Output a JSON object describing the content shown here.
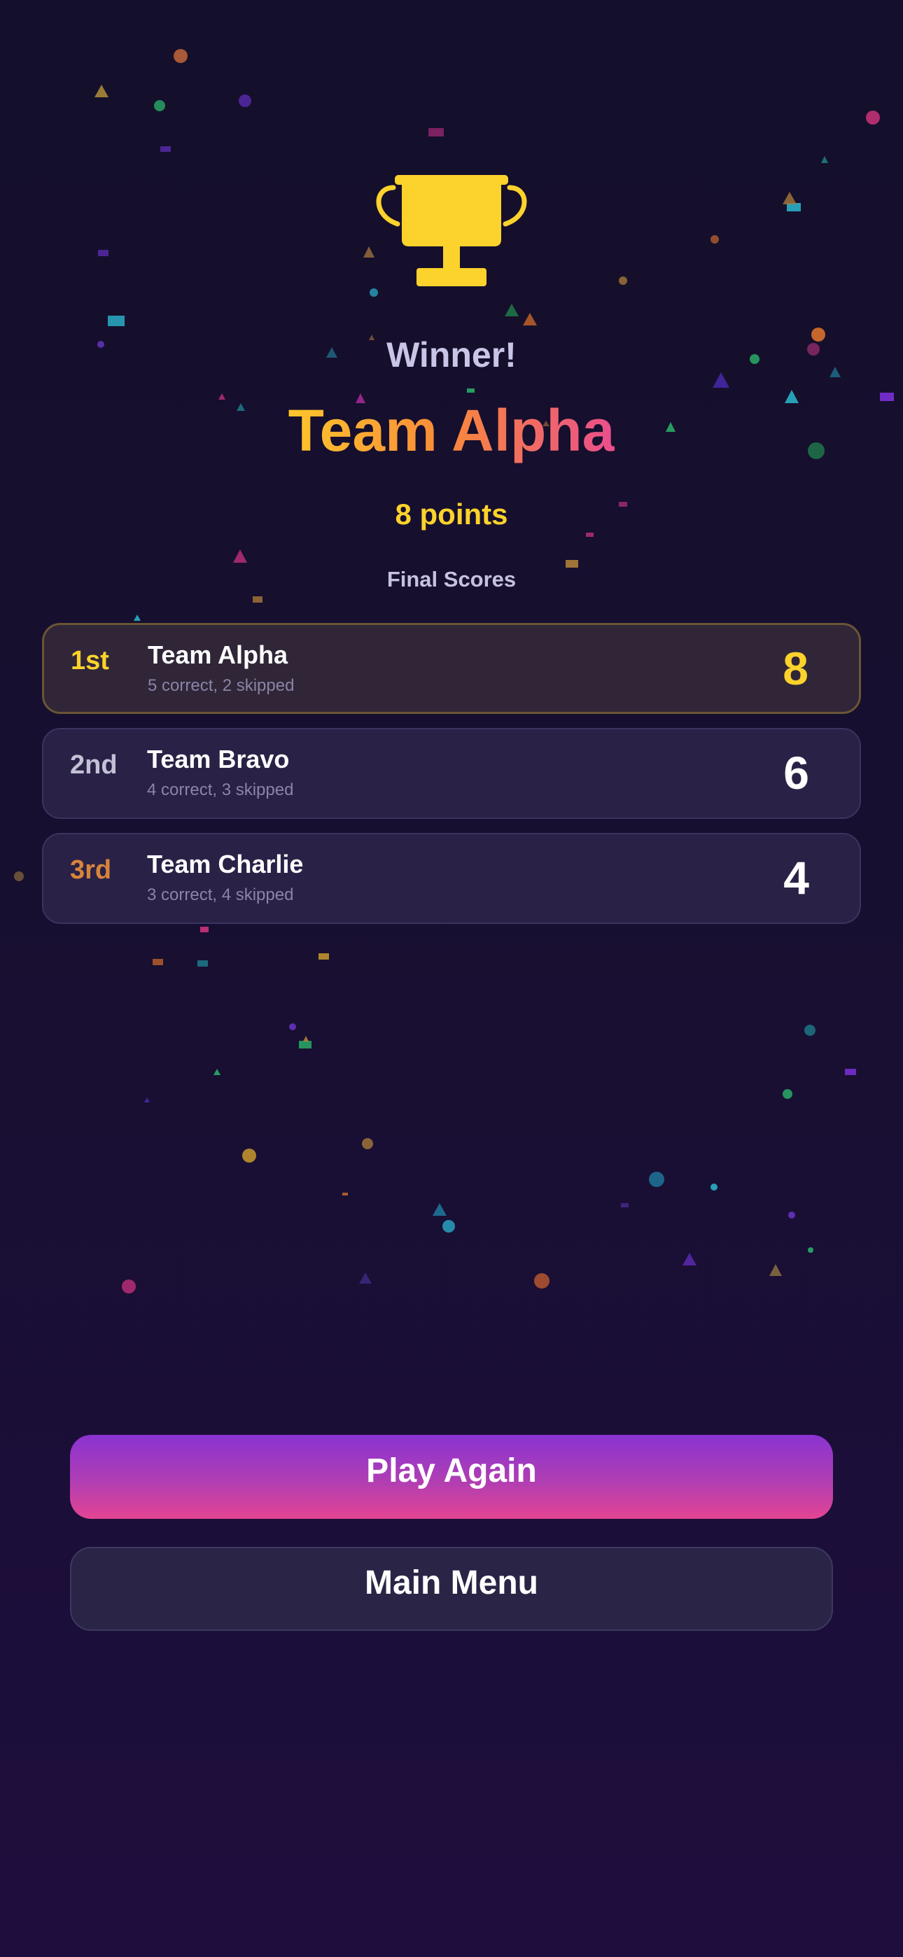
{
  "winner": {
    "label": "Winner!",
    "team": "Team Alpha",
    "points": "8 points"
  },
  "final_scores": {
    "title": "Final Scores",
    "rows": [
      {
        "rank": "1st",
        "team": "Team Alpha",
        "stats": "5 correct, 2 skipped",
        "score": "8",
        "rank_color": "#fcd22c",
        "score_color": "#fcd22c"
      },
      {
        "rank": "2nd",
        "team": "Team Bravo",
        "stats": "4 correct, 3 skipped",
        "score": "6",
        "rank_color": "#c3c1d6",
        "score_color": "#ffffff"
      },
      {
        "rank": "3rd",
        "team": "Team Charlie",
        "stats": "3 correct, 4 skipped",
        "score": "4",
        "rank_color": "#d9843b",
        "score_color": "#ffffff"
      }
    ]
  },
  "buttons": {
    "play_again": "Play Again",
    "main_menu": "Main Menu"
  },
  "icons": {
    "trophy": "trophy-icon"
  },
  "colors": {
    "background_top": "#140f2a",
    "background_bottom": "#1e0e3e",
    "trophy": "#fcd22c",
    "accent_gold": "#fcd22c",
    "accent_pink": "#e44492",
    "accent_purple": "#8a33d2"
  }
}
